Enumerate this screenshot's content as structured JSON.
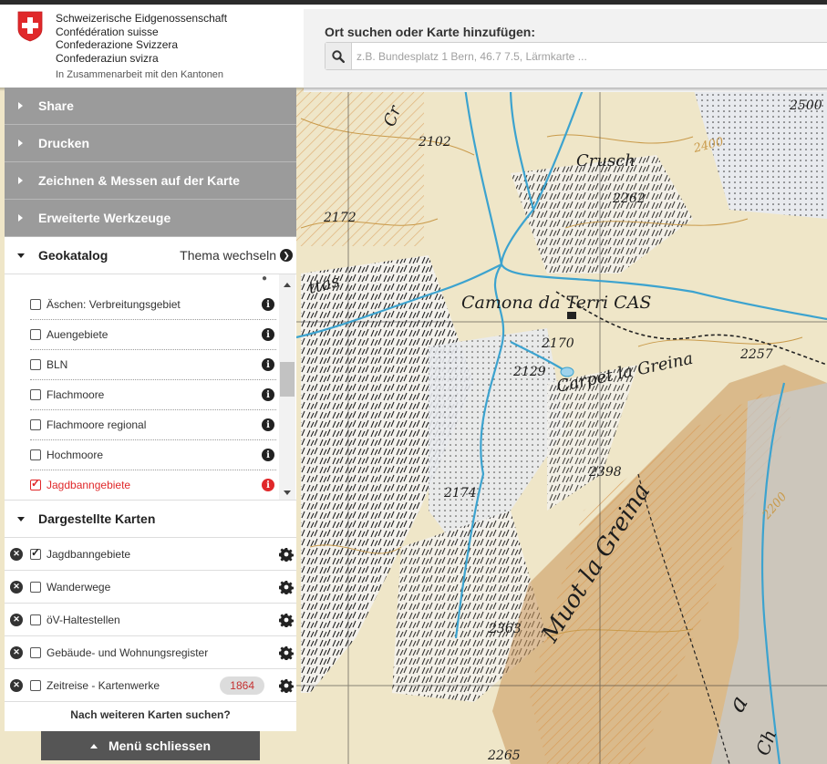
{
  "header": {
    "gov_lines": [
      "Schweizerische Eidgenossenschaft",
      "Confédération suisse",
      "Confederazione Svizzera",
      "Confederaziun svizra"
    ],
    "gov_sub": "In Zusammenarbeit mit den Kantonen",
    "logo_icon": "swiss-cross-icon",
    "accent": "#e0282a"
  },
  "search": {
    "title": "Ort suchen oder Karte hinzufügen:",
    "placeholder": "z.B. Bundesplatz 1 Bern, 46.7 7.5, Lärmkarte ...",
    "value": ""
  },
  "accordion": [
    {
      "label": "Share"
    },
    {
      "label": "Drucken"
    },
    {
      "label": "Zeichnen & Messen auf der Karte"
    },
    {
      "label": "Erweiterte Werkzeuge"
    }
  ],
  "geokatalog": {
    "title": "Geokatalog",
    "switch_label": "Thema wechseln",
    "items": [
      {
        "label": "Äschen: Verbreitungsgebiet",
        "checked": false
      },
      {
        "label": "Auengebiete",
        "checked": false
      },
      {
        "label": "BLN",
        "checked": false
      },
      {
        "label": "Flachmoore",
        "checked": false
      },
      {
        "label": "Flachmoore regional",
        "checked": false
      },
      {
        "label": "Hochmoore",
        "checked": false
      },
      {
        "label": "Jagdbanngebiete",
        "checked": true
      }
    ]
  },
  "displayed_maps": {
    "title": "Dargestellte Karten",
    "items": [
      {
        "label": "Jagdbanngebiete",
        "checked": true
      },
      {
        "label": "Wanderwege",
        "checked": false
      },
      {
        "label": "öV-Haltestellen",
        "checked": false
      },
      {
        "label": "Gebäude- und Wohnungsregister",
        "checked": false
      },
      {
        "label": "Zeitreise - Kartenwerke",
        "checked": false,
        "badge": "1864"
      }
    ],
    "more_label": "Nach weiteren Karten suchen?"
  },
  "close_menu_label": "Menü schliessen",
  "map": {
    "labels": {
      "camona": "Camona da Terri CAS",
      "carpet": "Carpet la Greina",
      "crusch": "Crusch",
      "muot": "Muot la Greina",
      "ga": "a",
      "pass": "ttas",
      "cr": "Cr",
      "ch": "Ch"
    },
    "spot_heights": [
      "2102",
      "2172",
      "2262",
      "2400",
      "2170",
      "2129",
      "2257",
      "2398",
      "2174",
      "2363",
      "2200",
      "2265",
      "2500"
    ]
  }
}
